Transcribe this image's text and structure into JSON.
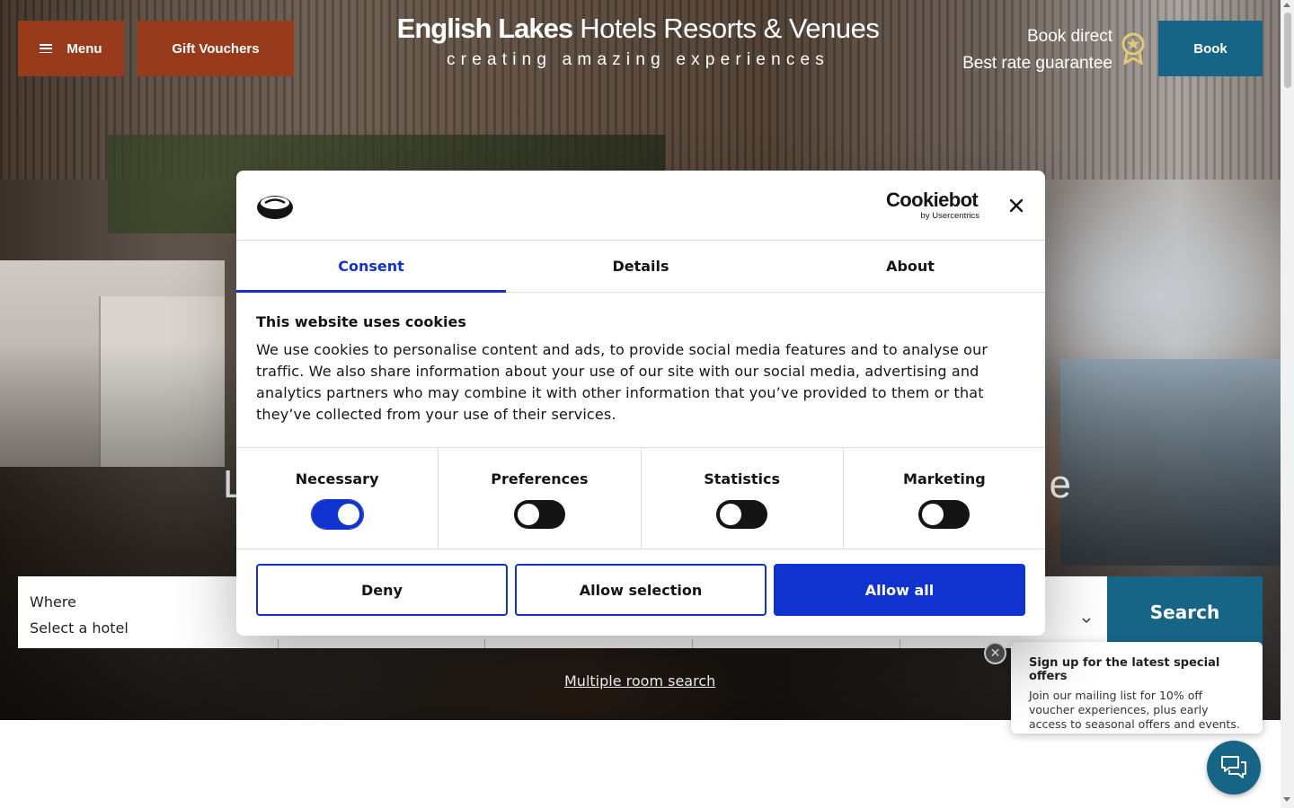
{
  "header": {
    "menu_label": "Menu",
    "gift_label": "Gift Vouchers",
    "brand_bold": "English Lakes",
    "brand_rest": "Hotels Resorts & Venues",
    "tagline": "creating amazing experiences",
    "book_direct_line1": "Book direct",
    "book_direct_line2": "Best rate guarantee",
    "book_label": "Book"
  },
  "hero": {
    "heading_left": "L",
    "heading_right": "e"
  },
  "search": {
    "where_label": "Where",
    "where_value": "Select a hotel",
    "search_label": "Search",
    "multi_room_label": "Multiple room search"
  },
  "signup": {
    "title": "Sign up for the latest special offers",
    "body": "Join our mailing list for 10% off voucher experiences, plus early access to seasonal offers and events."
  },
  "cookie_dialog": {
    "brand": "Cookiebot",
    "brand_sub": "by Usercentrics",
    "tabs": [
      {
        "label": "Consent"
      },
      {
        "label": "Details"
      },
      {
        "label": "About"
      }
    ],
    "heading": "This website uses cookies",
    "body": "We use cookies to personalise content and ads, to provide social media features and to analyse our traffic. We also share information about your use of our site with our social media, advertising and analytics partners who may combine it with other information that you’ve provided to them or that they’ve collected from your use of their services.",
    "toggles": [
      {
        "label": "Necessary",
        "on": true
      },
      {
        "label": "Preferences",
        "on": false
      },
      {
        "label": "Statistics",
        "on": false
      },
      {
        "label": "Marketing",
        "on": false
      }
    ],
    "deny_label": "Deny",
    "allow_selection_label": "Allow selection",
    "allow_all_label": "Allow all"
  },
  "colors": {
    "header_button": "#973b1c",
    "book_button": "#176586",
    "cookie_accent": "#1032cf"
  }
}
